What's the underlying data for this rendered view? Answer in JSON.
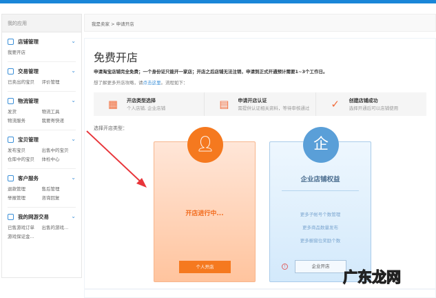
{
  "sidebar": {
    "header": "我的应用",
    "groups": [
      {
        "title": "店铺管理",
        "icon": "shop-icon",
        "links": [
          "我要开店"
        ]
      },
      {
        "title": "交易管理",
        "icon": "trade-icon",
        "links": [
          "已卖出的宝贝",
          "评价管理"
        ]
      },
      {
        "title": "物流管理",
        "icon": "truck-icon",
        "links": [
          "发货",
          "物流工具",
          "物流服务",
          "我要寄快递"
        ]
      },
      {
        "title": "宝贝管理",
        "icon": "shirt-icon",
        "links": [
          "发布宝贝",
          "出售中的宝贝",
          "仓库中的宝贝",
          "体检中心"
        ]
      },
      {
        "title": "客户服务",
        "icon": "user-service-icon",
        "links": [
          "退款管理",
          "售后管理",
          "举报管理",
          "咨询回复"
        ]
      },
      {
        "title": "我的网游交易",
        "icon": "gamepad-icon",
        "links": [
          "已售游戏订单",
          "出售的游戏...",
          "游戏保证金..."
        ]
      }
    ]
  },
  "breadcrumb": {
    "root": "我是卖家",
    "sep": ">",
    "current": "申请开店"
  },
  "main": {
    "title": "免费开店",
    "desc1": "申请淘宝店铺完全免费；一个身份证只能开一家店；开店之后店铺无法注销，申请到正式开通预计需要1~3个工作日。",
    "desc2_pre": "想了解更多开店攻略，请",
    "desc2_link": "点击这里",
    "desc2_post": "。流程如下：",
    "steps": [
      {
        "title": "开店类型选择",
        "sub": "个人店铺, 企业店铺"
      },
      {
        "title": "申请开店认证",
        "sub": "需提供认证相关资料，等待审核通过"
      },
      {
        "title": "创建店铺成功",
        "sub": "选择开通后可以店铺使用"
      }
    ],
    "choose_label": "选择开店类型：",
    "personal": {
      "status": "开店进行中...",
      "button": "个人开店"
    },
    "enterprise": {
      "title": "企业店铺权益",
      "benefits": [
        "更多子帐号个数管理",
        "更多商品数量发布",
        "更多橱窗位奖励个数"
      ],
      "button": "企业开店"
    }
  },
  "watermark": "广东龙网",
  "colors": {
    "accent_orange": "#f5791f",
    "accent_blue": "#5a9fd8",
    "topbar": "#1a86d8"
  }
}
